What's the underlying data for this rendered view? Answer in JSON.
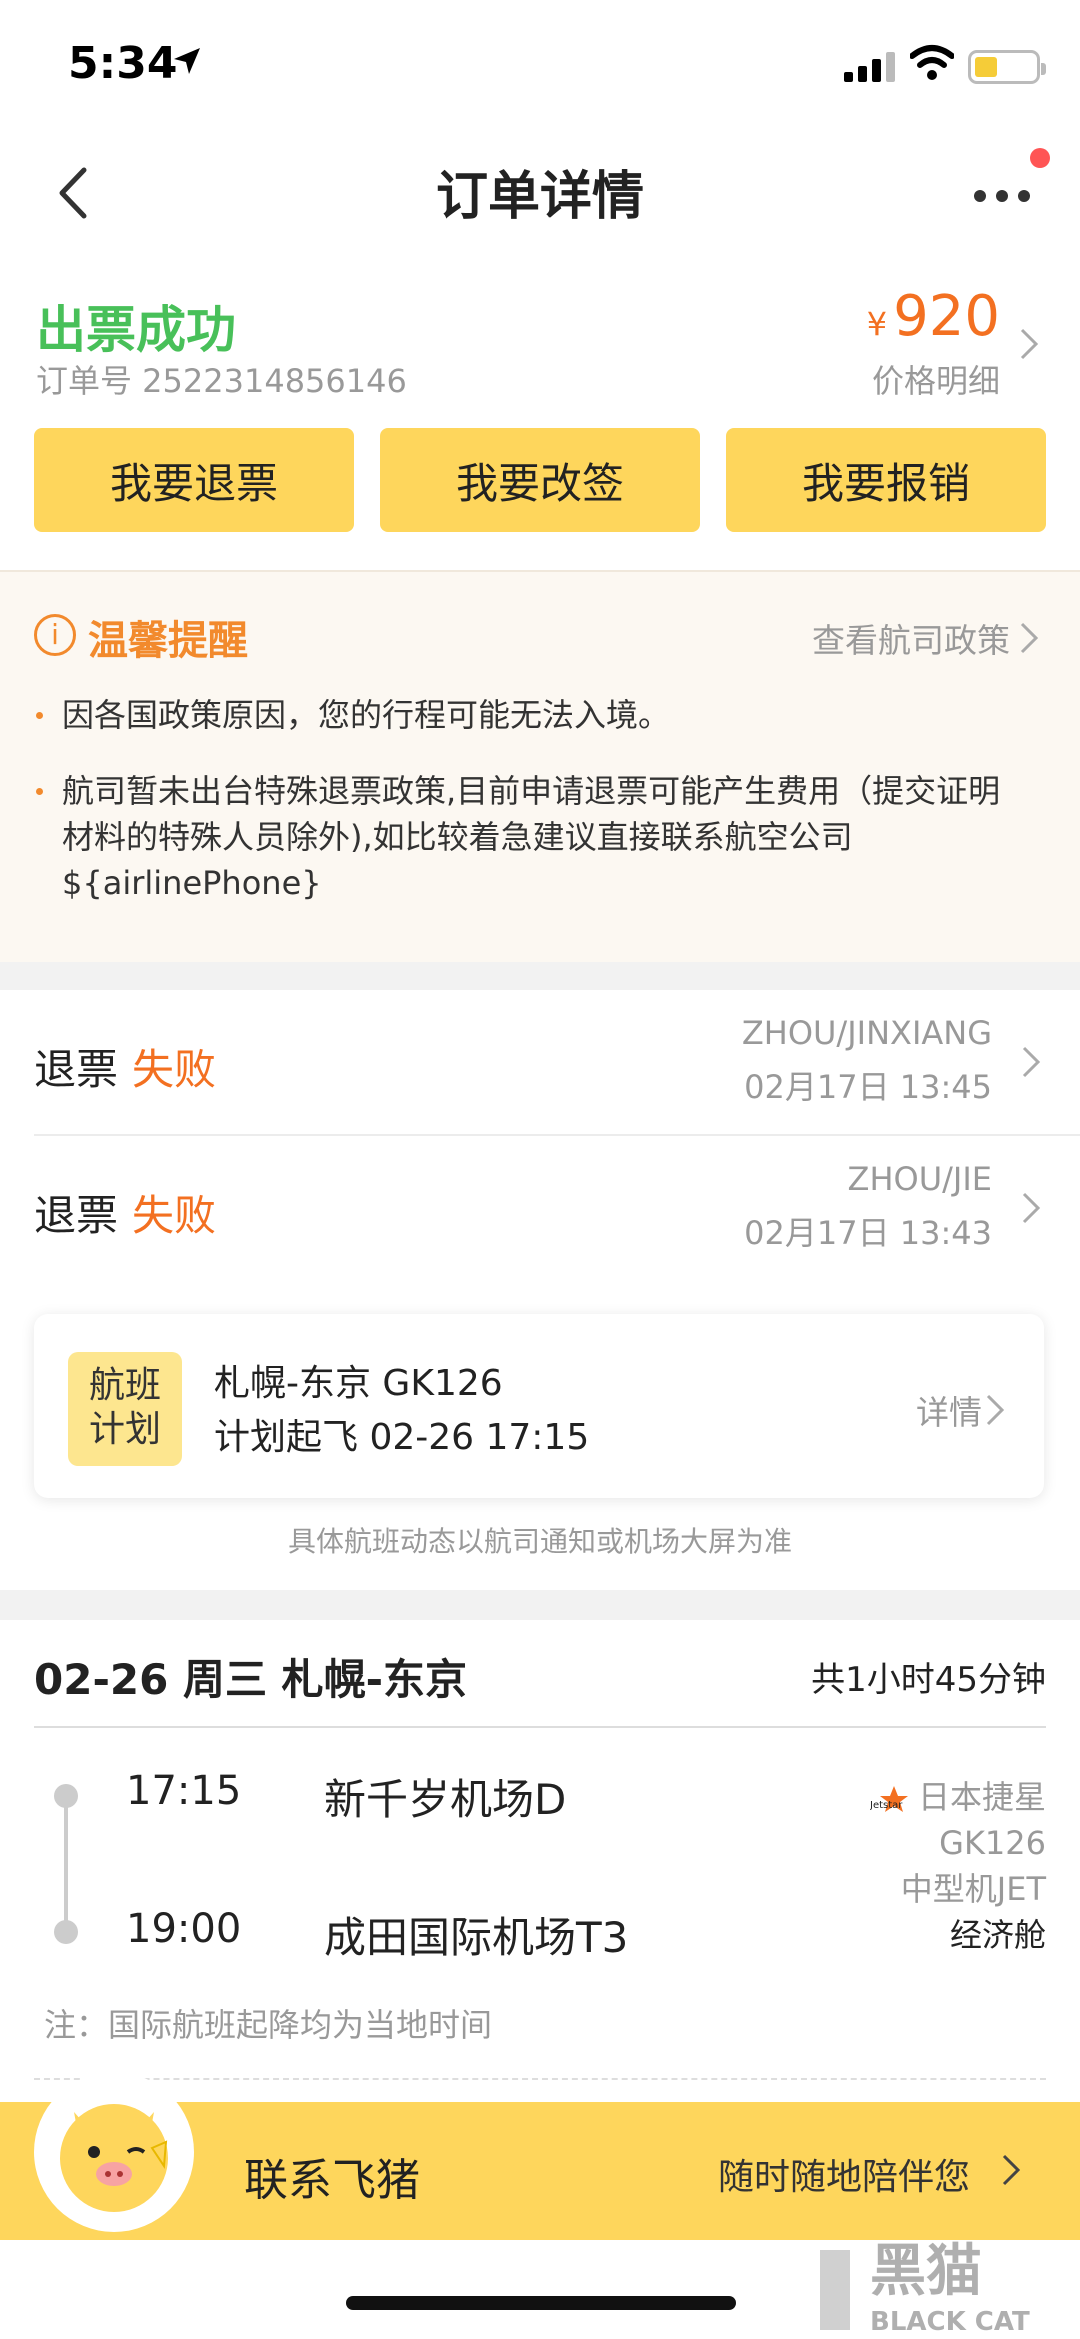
{
  "status_bar": {
    "time": "5:34"
  },
  "nav": {
    "title": "订单详情"
  },
  "order": {
    "status": "出票成功",
    "order_no": "订单号 2522314856146",
    "currency": "¥",
    "price": "920",
    "price_detail": "价格明细"
  },
  "actions": [
    "我要退票",
    "我要改签",
    "我要报销"
  ],
  "reminder": {
    "title": "温馨提醒",
    "link": "查看航司政策",
    "items": [
      "因各国政策原因，您的行程可能无法入境。",
      "航司暂未出台特殊退票政策,目前申请退票可能产生费用（提交证明材料的特殊人员除外),如比较着急建议直接联系航空公司${airlinePhone}"
    ]
  },
  "refunds": [
    {
      "label": "退票",
      "status": "失败",
      "name": "ZHOU/JINXIANG",
      "datetime": "02月17日 13:45"
    },
    {
      "label": "退票",
      "status": "失败",
      "name": "ZHOU/JIE",
      "datetime": "02月17日 13:43"
    }
  ],
  "flight_plan": {
    "badge_line1": "航班",
    "badge_line2": "计划",
    "route": "札幌-东京 GK126",
    "departure": "计划起飞 02-26 17:15",
    "link": "详情",
    "note": "具体航班动态以航司通知或机场大屏为准"
  },
  "itinerary": {
    "header": "02-26 周三 札幌-东京",
    "duration": "共1小时45分钟",
    "departure": {
      "time": "17:15",
      "airport": "新千岁机场D"
    },
    "arrival": {
      "time": "19:00",
      "airport": "成田国际机场T3"
    },
    "airline": "日本捷星",
    "airline_logo_text": "Jetstar",
    "flight_no": "GK126",
    "aircraft": "中型机JET",
    "cabin": "经济舱",
    "note": "注：国际航班起降均为当地时间"
  },
  "contact": {
    "label": "联系飞猪",
    "slogan": "随时随地陪伴您"
  },
  "watermark": {
    "cn": "黑猫",
    "en": "BLACK CAT"
  },
  "colors": {
    "accent_yellow": "#fed65c",
    "success_green": "#48c059",
    "price_orange": "#f37021",
    "warning_orange": "#f28a2d"
  }
}
